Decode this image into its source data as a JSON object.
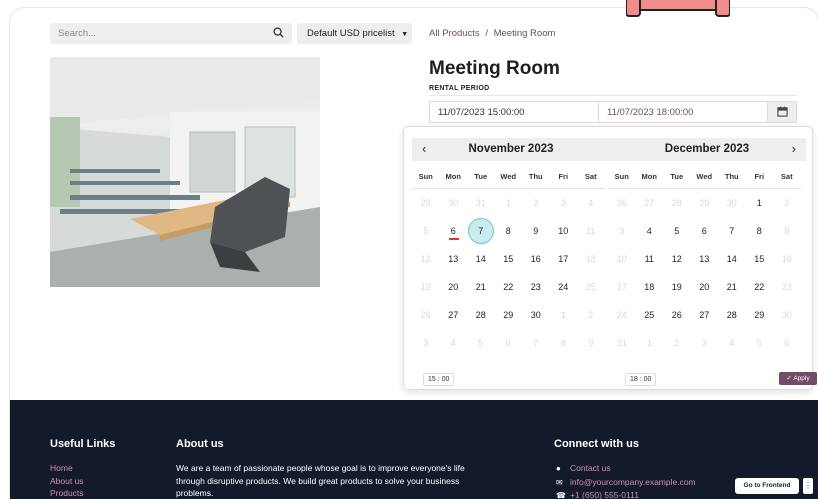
{
  "header": {
    "search_placeholder": "Search...",
    "pricelist_label": "Default USD pricelist",
    "breadcrumb": {
      "link": "All Products",
      "separator": "/",
      "current": "Meeting Room"
    }
  },
  "product": {
    "title": "Meeting Room",
    "rental_label": "RENTAL PERIOD",
    "start": "11/07/2023 15:00:00",
    "end": "11/07/2023 18:00:00"
  },
  "picker": {
    "weekdays": [
      "Sun",
      "Mon",
      "Tue",
      "Wed",
      "Thu",
      "Fri",
      "Sat"
    ],
    "months": [
      {
        "title": "November 2023",
        "nav": "‹",
        "days": [
          [
            "29",
            "m"
          ],
          [
            "30",
            "m"
          ],
          [
            "31",
            "m"
          ],
          [
            "1",
            "m"
          ],
          [
            "2",
            "m"
          ],
          [
            "3",
            "m"
          ],
          [
            "4",
            "m"
          ],
          [
            "5",
            "m"
          ],
          [
            "6",
            "today"
          ],
          [
            "7",
            "sel"
          ],
          [
            "8",
            ""
          ],
          [
            "9",
            ""
          ],
          [
            "10",
            ""
          ],
          [
            "11",
            "m"
          ],
          [
            "12",
            "m"
          ],
          [
            "13",
            ""
          ],
          [
            "14",
            ""
          ],
          [
            "15",
            ""
          ],
          [
            "16",
            ""
          ],
          [
            "17",
            ""
          ],
          [
            "18",
            "m"
          ],
          [
            "19",
            "m"
          ],
          [
            "20",
            ""
          ],
          [
            "21",
            ""
          ],
          [
            "22",
            ""
          ],
          [
            "23",
            ""
          ],
          [
            "24",
            ""
          ],
          [
            "25",
            "m"
          ],
          [
            "26",
            "m"
          ],
          [
            "27",
            ""
          ],
          [
            "28",
            ""
          ],
          [
            "29",
            ""
          ],
          [
            "30",
            ""
          ],
          [
            "1",
            "m"
          ],
          [
            "2",
            "m"
          ],
          [
            "3",
            "m"
          ],
          [
            "4",
            "m"
          ],
          [
            "5",
            "m"
          ],
          [
            "6",
            "m"
          ],
          [
            "7",
            "m"
          ],
          [
            "8",
            "m"
          ],
          [
            "9",
            "m"
          ]
        ],
        "time_h": "15",
        "time_m": "00"
      },
      {
        "title": "December 2023",
        "nav": "›",
        "days": [
          [
            "26",
            "m"
          ],
          [
            "27",
            "m"
          ],
          [
            "28",
            "m"
          ],
          [
            "29",
            "m"
          ],
          [
            "30",
            "m"
          ],
          [
            "1",
            ""
          ],
          [
            "2",
            "m"
          ],
          [
            "3",
            "m"
          ],
          [
            "4",
            ""
          ],
          [
            "5",
            ""
          ],
          [
            "6",
            ""
          ],
          [
            "7",
            ""
          ],
          [
            "8",
            ""
          ],
          [
            "9",
            "m"
          ],
          [
            "10",
            "m"
          ],
          [
            "11",
            ""
          ],
          [
            "12",
            ""
          ],
          [
            "13",
            ""
          ],
          [
            "14",
            ""
          ],
          [
            "15",
            ""
          ],
          [
            "16",
            "m"
          ],
          [
            "17",
            "m"
          ],
          [
            "18",
            ""
          ],
          [
            "19",
            ""
          ],
          [
            "20",
            ""
          ],
          [
            "21",
            ""
          ],
          [
            "22",
            ""
          ],
          [
            "23",
            "m"
          ],
          [
            "24",
            "m"
          ],
          [
            "25",
            ""
          ],
          [
            "26",
            ""
          ],
          [
            "27",
            ""
          ],
          [
            "28",
            ""
          ],
          [
            "29",
            ""
          ],
          [
            "30",
            "m"
          ],
          [
            "31",
            "m"
          ],
          [
            "1",
            "m"
          ],
          [
            "2",
            "m"
          ],
          [
            "3",
            "m"
          ],
          [
            "4",
            "m"
          ],
          [
            "5",
            "m"
          ],
          [
            "6",
            "m"
          ]
        ],
        "time_h": "18",
        "time_m": "00"
      }
    ],
    "apply_label": "✓ Apply"
  },
  "footer": {
    "links_title": "Useful Links",
    "links": [
      "Home",
      "About us",
      "Products"
    ],
    "about_title": "About us",
    "about_text": "We are a team of passionate people whose goal is to improve everyone's life through disruptive products. We build great products to solve your business problems.",
    "connect_title": "Connect with us",
    "contact": [
      "Contact us",
      "info@yourcompany.example.com",
      "+1 (650) 555-0111"
    ],
    "go_frontend": "Go to Frontend",
    "kebab": "⋮"
  },
  "colors": {
    "brand": "#714b67",
    "footer_bg": "#121a2b",
    "selected_day": "#c9ecef"
  },
  "icons": [
    "search-icon",
    "caret-down-icon",
    "calendar-icon",
    "chevron-left-icon",
    "chevron-right-icon",
    "check-icon",
    "comment-icon",
    "envelope-icon",
    "phone-icon"
  ]
}
